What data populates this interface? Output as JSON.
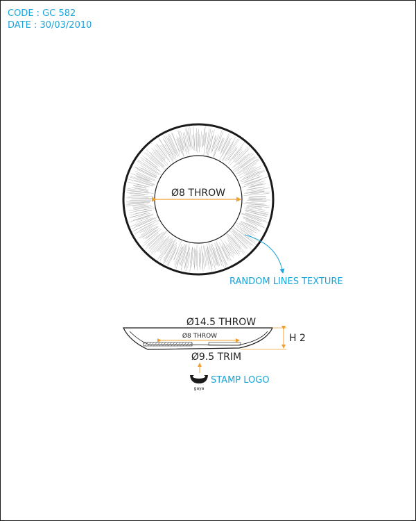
{
  "meta": {
    "code": "CODE : GC 582",
    "date": "DATE : 30/03/2010"
  },
  "top_view": {
    "inner_dim": "Ø8 THROW",
    "texture_note": "RANDOM LINES TEXTURE"
  },
  "side_view": {
    "outer_dim": "Ø14.5 THROW",
    "inner_dim": "Ø8 THROW",
    "trim_dim": "Ø9.5 TRIM",
    "height_dim": "H 2",
    "stamp_note": "STAMP LOGO",
    "logo_text": "gaya"
  },
  "colors": {
    "annotation": "#1aa3d9",
    "dimension": "#f0a030",
    "line": "#1a1a1a"
  }
}
